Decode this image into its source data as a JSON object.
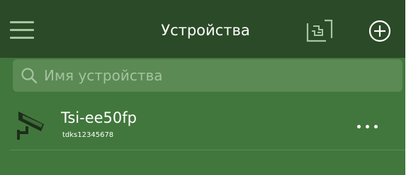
{
  "header": {
    "title": "Устройства",
    "menu_icon": "hamburger-menu-icon",
    "scan_icon": "qr-scan-icon",
    "add_icon": "add-circle-icon"
  },
  "search": {
    "placeholder": "Имя устройства",
    "icon": "search-icon"
  },
  "devices": [
    {
      "name": "Tsi-ee50fp",
      "id": "tdks12345678",
      "icon": "security-camera-icon",
      "more_icon": "more-dots-icon"
    }
  ],
  "colors": {
    "header_bg": "#2b4a27",
    "body_bg": "#41773c",
    "search_bg": "#5b8a55",
    "placeholder": "#a4c39e",
    "icon_light": "#a5c7a0",
    "text": "#ffffff"
  }
}
